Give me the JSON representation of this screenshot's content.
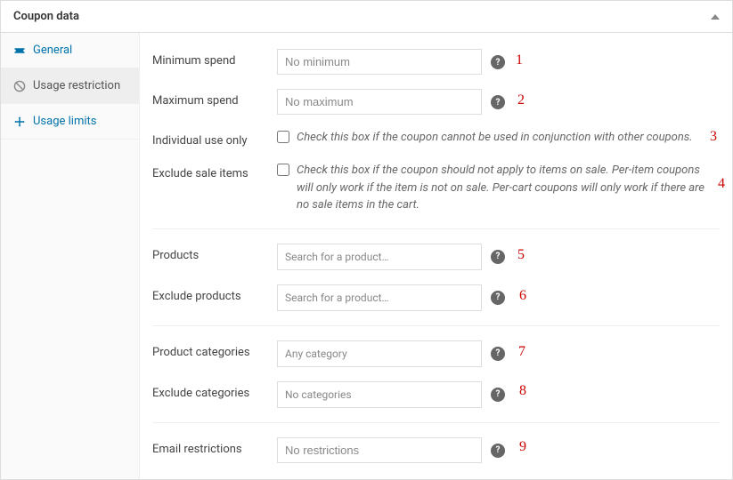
{
  "panel": {
    "title": "Coupon data"
  },
  "tabs": {
    "general": "General",
    "usage_restriction": "Usage restriction",
    "usage_limits": "Usage limits"
  },
  "fields": {
    "min_spend": {
      "label": "Minimum spend",
      "placeholder": "No minimum"
    },
    "max_spend": {
      "label": "Maximum spend",
      "placeholder": "No maximum"
    },
    "individual_use": {
      "label": "Individual use only",
      "desc": "Check this box if the coupon cannot be used in conjunction with other coupons."
    },
    "exclude_sale": {
      "label": "Exclude sale items",
      "desc": "Check this box if the coupon should not apply to items on sale. Per-item coupons will only work if the item is not on sale. Per-cart coupons will only work if there are no sale items in the cart."
    },
    "products": {
      "label": "Products",
      "placeholder": "Search for a product…"
    },
    "exclude_products": {
      "label": "Exclude products",
      "placeholder": "Search for a product…"
    },
    "product_categories": {
      "label": "Product categories",
      "placeholder": "Any category"
    },
    "exclude_categories": {
      "label": "Exclude categories",
      "placeholder": "No categories"
    },
    "email_restrictions": {
      "label": "Email restrictions",
      "placeholder": "No restrictions"
    }
  },
  "annotations": {
    "n1": "1",
    "n2": "2",
    "n3": "3",
    "n4": "4",
    "n5": "5",
    "n6": "6",
    "n7": "7",
    "n8": "8",
    "n9": "9"
  }
}
